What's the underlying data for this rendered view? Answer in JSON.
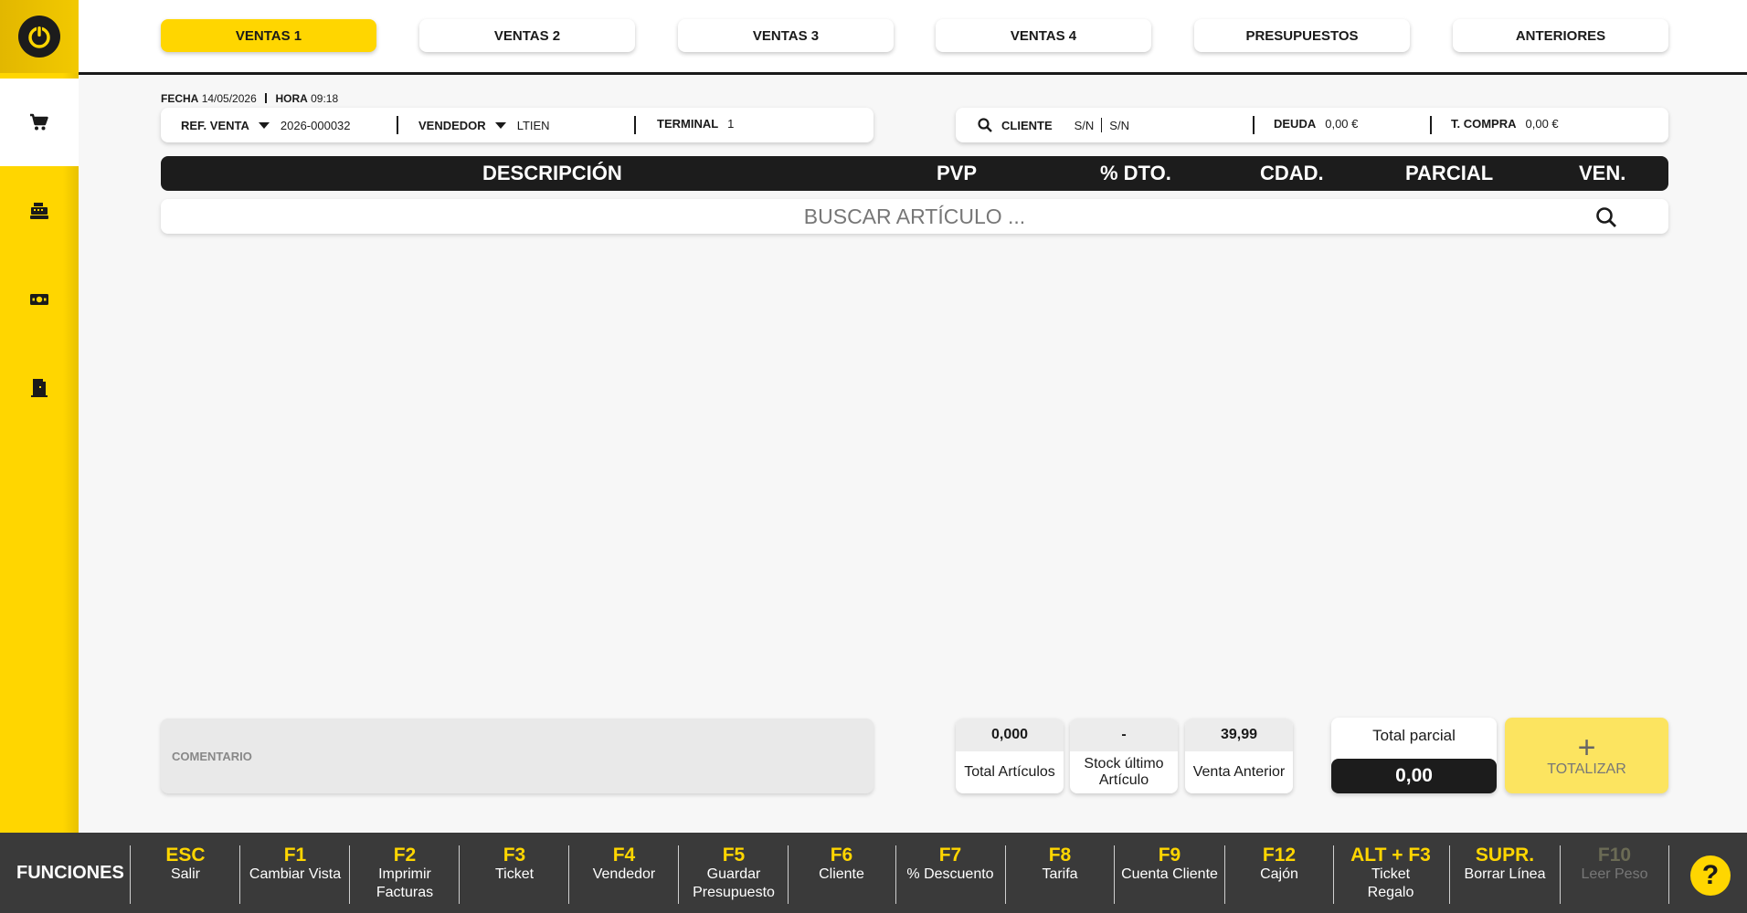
{
  "tabs": [
    {
      "label": "VENTAS 1",
      "active": true
    },
    {
      "label": "VENTAS 2",
      "active": false
    },
    {
      "label": "VENTAS 3",
      "active": false
    },
    {
      "label": "VENTAS 4",
      "active": false
    },
    {
      "label": "PRESUPUESTOS",
      "active": false
    },
    {
      "label": "ANTERIORES",
      "active": false
    }
  ],
  "sidebar": {
    "items": [
      {
        "icon": "cart-icon",
        "active": true
      },
      {
        "icon": "cash-register-icon",
        "active": false
      },
      {
        "icon": "money-icon",
        "active": false
      },
      {
        "icon": "door-exit-icon",
        "active": false
      }
    ]
  },
  "header": {
    "fecha_label": "FECHA",
    "fecha": "14/05/2026",
    "hora_label": "HORA",
    "hora": "09:18",
    "ref_label": "REF. VENTA",
    "ref_value": "2026-000032",
    "vendedor_label": "VENDEDOR",
    "vendedor_value": "LTIEN",
    "terminal_label": "TERMINAL",
    "terminal_value": "1",
    "cliente_label": "CLIENTE",
    "cliente_code": "S/N",
    "cliente_name": "S/N",
    "deuda_label": "DEUDA",
    "deuda_value": "0,00 €",
    "tcompra_label": "T. COMPRA",
    "tcompra_value": "0,00 €"
  },
  "table": {
    "columns": [
      "DESCRIPCIÓN",
      "PVP",
      "% DTO.",
      "CDAD.",
      "PARCIAL",
      "VEN."
    ]
  },
  "search": {
    "placeholder": "BUSCAR ARTÍCULO ..."
  },
  "bottom": {
    "comment_label": "COMENTARIO",
    "stats": [
      {
        "value": "0,000",
        "label": "Total Artículos"
      },
      {
        "value": "-",
        "label": "Stock último Artículo"
      },
      {
        "value": "39,99",
        "label": "Venta Anterior"
      }
    ],
    "total_label": "Total parcial",
    "total_value": "0,00",
    "totalizar_plus": "+",
    "totalizar_label": "TOTALIZAR"
  },
  "footer": {
    "title": "FUNCIONES",
    "keys": [
      {
        "key": "ESC",
        "desc": "Salir"
      },
      {
        "key": "F1",
        "desc": "Cambiar Vista"
      },
      {
        "key": "F2",
        "desc": "Imprimir Facturas"
      },
      {
        "key": "F3",
        "desc": "Ticket"
      },
      {
        "key": "F4",
        "desc": "Vendedor"
      },
      {
        "key": "F5",
        "desc": "Guardar Presupuesto"
      },
      {
        "key": "F6",
        "desc": "Cliente"
      },
      {
        "key": "F7",
        "desc": "% Descuento"
      },
      {
        "key": "F8",
        "desc": "Tarifa"
      },
      {
        "key": "F9",
        "desc": "Cuenta Cliente"
      },
      {
        "key": "F12",
        "desc": "Cajón"
      },
      {
        "key": "ALT + F3",
        "desc": "Ticket Regalo"
      },
      {
        "key": "SUPR.",
        "desc": "Borrar Línea"
      },
      {
        "key": "F10",
        "desc": "Leer Peso",
        "disabled": true
      }
    ],
    "help": "?"
  },
  "colors": {
    "accent": "#ffd600",
    "dark": "#1c1c1c",
    "footer": "#3a3a3a"
  }
}
